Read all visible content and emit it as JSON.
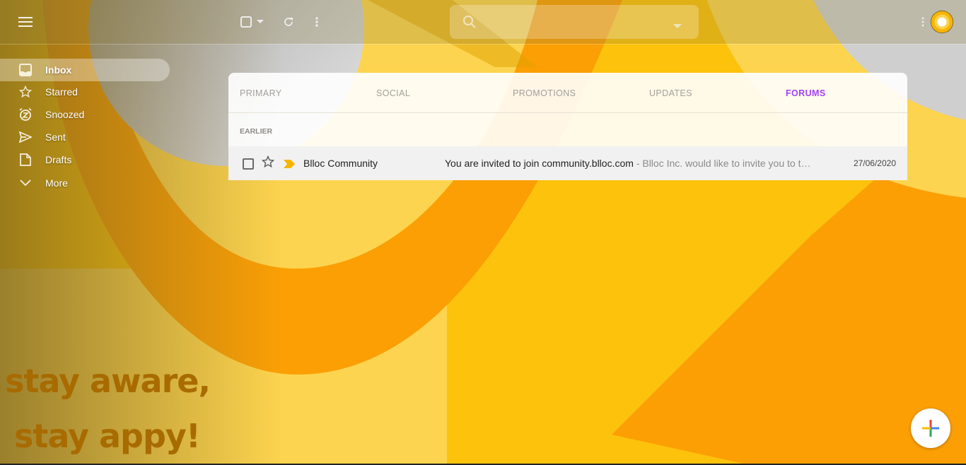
{
  "header": {
    "menu_icon": "hamburger-menu-icon",
    "select_icon": "checkbox-icon",
    "select_dropdown_icon": "caret-down-icon",
    "refresh_icon": "refresh-icon",
    "more_icon": "more-vert-icon",
    "search": {
      "placeholder": "",
      "value": "",
      "icon": "search-icon",
      "options_icon": "caret-down-icon"
    },
    "apps_icon": "more-vert-icon",
    "avatar_icon": "account-avatar-icon"
  },
  "sidebar": {
    "items": [
      {
        "label": "Inbox",
        "icon": "inbox-icon",
        "active": true
      },
      {
        "label": "Starred",
        "icon": "star-icon"
      },
      {
        "label": "Snoozed",
        "icon": "snooze-clock-icon"
      },
      {
        "label": "Sent",
        "icon": "send-icon"
      },
      {
        "label": "Drafts",
        "icon": "draft-file-icon"
      },
      {
        "label": "More",
        "icon": "chevron-down-icon"
      }
    ]
  },
  "main": {
    "tabs": [
      {
        "label": "PRIMARY"
      },
      {
        "label": "SOCIAL"
      },
      {
        "label": "PROMOTIONS"
      },
      {
        "label": "UPDATES"
      },
      {
        "label": "FORUMS",
        "active": true
      }
    ],
    "section_label": "EARLIER",
    "emails": [
      {
        "sender": "Blloc Community",
        "subject": "You are invited to join community.blloc.com",
        "snippet": " - Blloc Inc. would like to invite you to t…",
        "date": "27/06/2020",
        "starred": false,
        "important": true
      }
    ]
  },
  "slogan": {
    "line1": "stay aware,",
    "line2": "stay appy!"
  },
  "compose": {
    "icon": "compose-plus-icon"
  },
  "colors": {
    "accent": "#a142f4",
    "important_marker": "#f7b500",
    "slogan": "#a86b00",
    "plus_red": "#ea4335",
    "plus_blue": "#4285f4",
    "plus_green": "#34a853",
    "plus_yellow": "#fbbc04"
  }
}
